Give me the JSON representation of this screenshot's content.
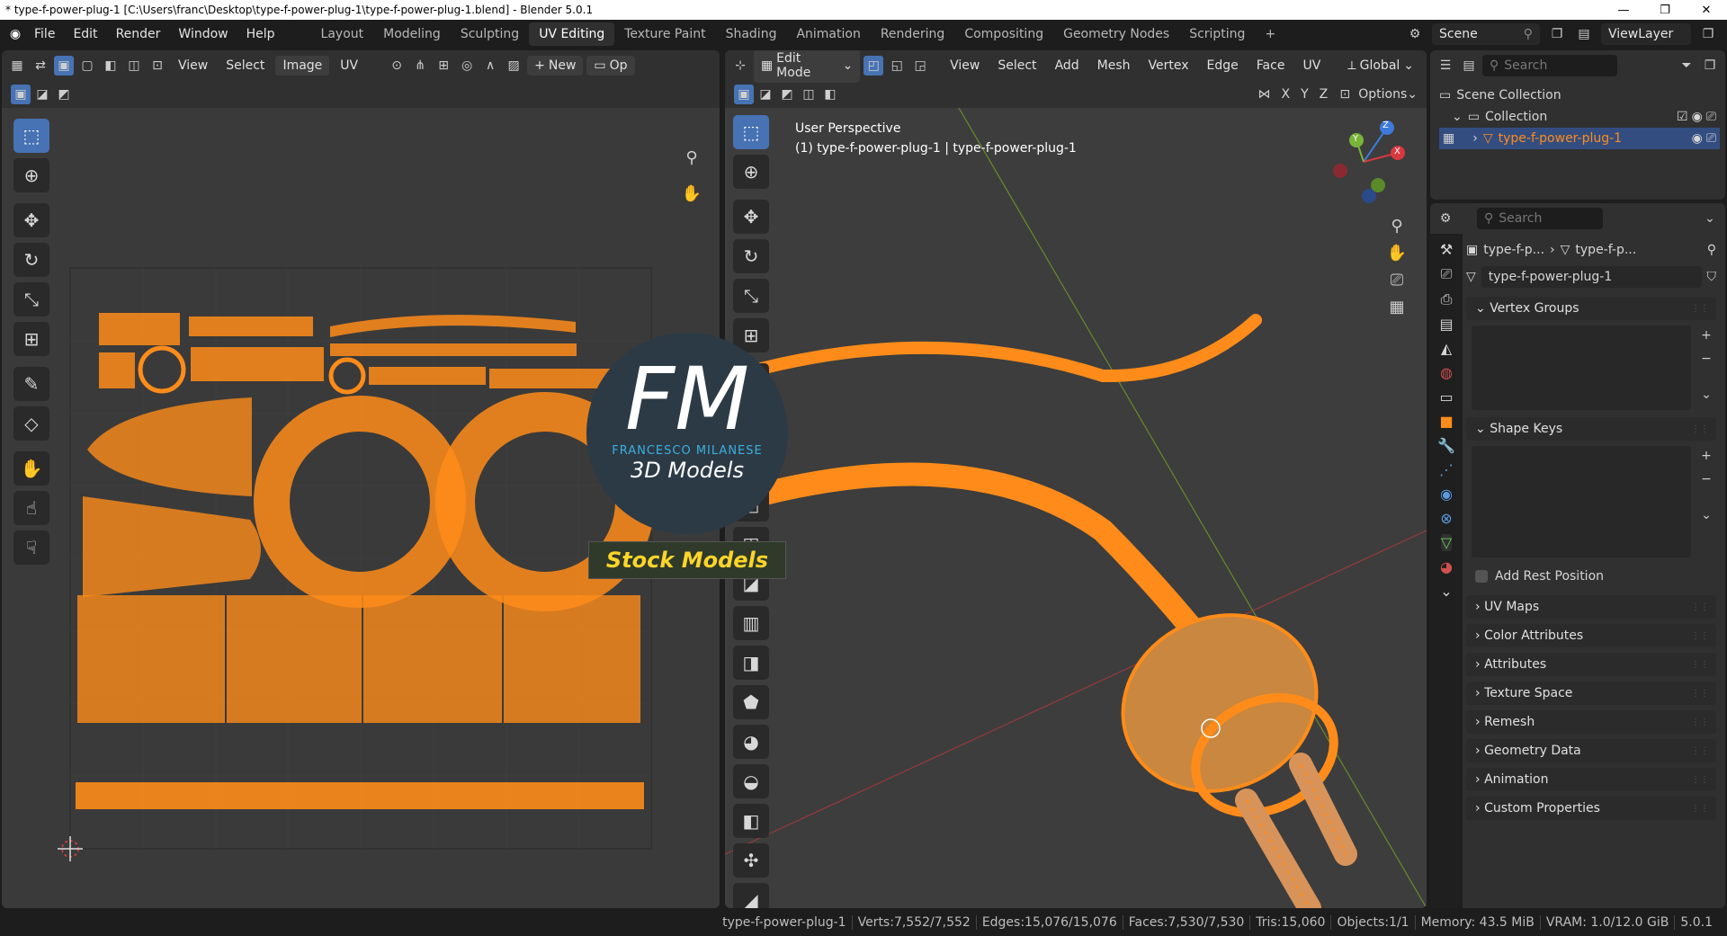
{
  "window": {
    "title": "* type-f-power-plug-1 [C:\\Users\\franc\\Desktop\\type-f-power-plug-1\\type-f-power-plug-1.blend] - Blender 5.0.1",
    "minimize": "—",
    "maximize": "❐",
    "close": "✕"
  },
  "menu": [
    "File",
    "Edit",
    "Render",
    "Window",
    "Help"
  ],
  "workspaces": [
    "Layout",
    "Modeling",
    "Sculpting",
    "UV Editing",
    "Texture Paint",
    "Shading",
    "Animation",
    "Rendering",
    "Compositing",
    "Geometry Nodes",
    "Scripting"
  ],
  "active_workspace_index": 3,
  "scene": {
    "label": "Scene",
    "view_layer": "ViewLayer"
  },
  "uv_editor": {
    "menus": [
      "View",
      "Select",
      "Image",
      "UV"
    ],
    "new_label": "New",
    "open_label": "Op"
  },
  "viewport": {
    "mode": "Edit Mode",
    "menus": [
      "View",
      "Select",
      "Add",
      "Mesh",
      "Vertex",
      "Edge",
      "Face",
      "UV"
    ],
    "transform_orientation": "Global",
    "options_label": "Options",
    "axes": [
      "X",
      "Y",
      "Z"
    ],
    "overlay_line1": "User Perspective",
    "overlay_line2": "(1) type-f-power-plug-1 | type-f-power-plug-1",
    "gizmo": {
      "x": "X",
      "y": "Y",
      "z": "Z"
    }
  },
  "watermark": {
    "logo": "FM",
    "name": "FRANCESCO MILANESE",
    "sub": "3D Models",
    "banner": "Stock Models"
  },
  "outliner": {
    "search_placeholder": "Search",
    "scene_collection": "Scene Collection",
    "collection": "Collection",
    "object": "type-f-power-plug-1"
  },
  "properties": {
    "search_placeholder": "Search",
    "breadcrumb_obj": "type-f-p...",
    "breadcrumb_mesh": "type-f-p...",
    "mesh_name": "type-f-power-plug-1",
    "panels_open": [
      "Vertex Groups",
      "Shape Keys"
    ],
    "add_rest_position": "Add Rest Position",
    "panels_closed": [
      "UV Maps",
      "Color Attributes",
      "Attributes",
      "Texture Space",
      "Remesh",
      "Geometry Data",
      "Animation",
      "Custom Properties"
    ]
  },
  "status": [
    "type-f-power-plug-1",
    "Verts:7,552/7,552",
    "Edges:15,076/15,076",
    "Faces:7,530/7,530",
    "Tris:15,060",
    "Objects:1/1",
    "Memory: 43.5 MiB",
    "VRAM: 1.0/12.0 GiB",
    "5.0.1"
  ],
  "colors": {
    "accent": "#4772b3",
    "mesh": "#ff8c1a",
    "active_ws": "#303030"
  }
}
